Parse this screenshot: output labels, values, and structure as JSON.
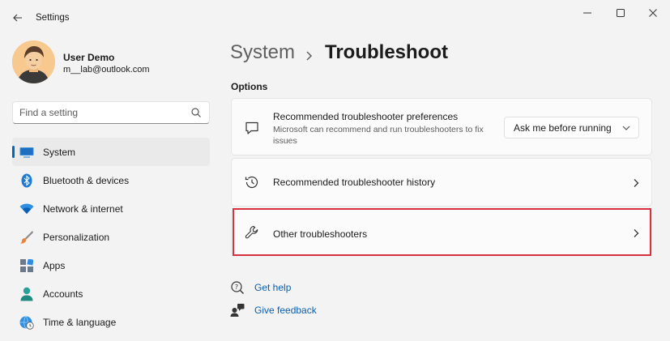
{
  "window": {
    "title": "Settings",
    "controls": [
      "minimize",
      "maximize",
      "close"
    ]
  },
  "profile": {
    "name": "User Demo",
    "email": "m__lab@outlook.com"
  },
  "search": {
    "placeholder": "Find a setting"
  },
  "sidebar": {
    "items": [
      {
        "label": "System",
        "icon": "monitor-icon",
        "active": true
      },
      {
        "label": "Bluetooth & devices",
        "icon": "bluetooth-icon",
        "active": false
      },
      {
        "label": "Network & internet",
        "icon": "wifi-icon",
        "active": false
      },
      {
        "label": "Personalization",
        "icon": "brush-icon",
        "active": false
      },
      {
        "label": "Apps",
        "icon": "apps-icon",
        "active": false
      },
      {
        "label": "Accounts",
        "icon": "person-icon",
        "active": false
      },
      {
        "label": "Time & language",
        "icon": "globe-clock-icon",
        "active": false
      }
    ]
  },
  "breadcrumb": {
    "parent": "System",
    "separator": "›",
    "current": "Troubleshoot"
  },
  "main": {
    "section_label": "Options",
    "preferences": {
      "title": "Recommended troubleshooter preferences",
      "description": "Microsoft can recommend and run troubleshooters to fix issues",
      "dropdown_value": "Ask me before running",
      "icon": "chat-icon"
    },
    "history": {
      "title": "Recommended troubleshooter history",
      "icon": "history-icon"
    },
    "other": {
      "title": "Other troubleshooters",
      "icon": "wrench-icon",
      "highlighted": true
    },
    "links": {
      "help": "Get help",
      "feedback": "Give feedback"
    }
  },
  "colors": {
    "accent": "#0067c0",
    "highlight_border": "#d6313c",
    "link": "#0a5eaf",
    "background": "#f3f3f3",
    "card": "#fbfbfb"
  }
}
